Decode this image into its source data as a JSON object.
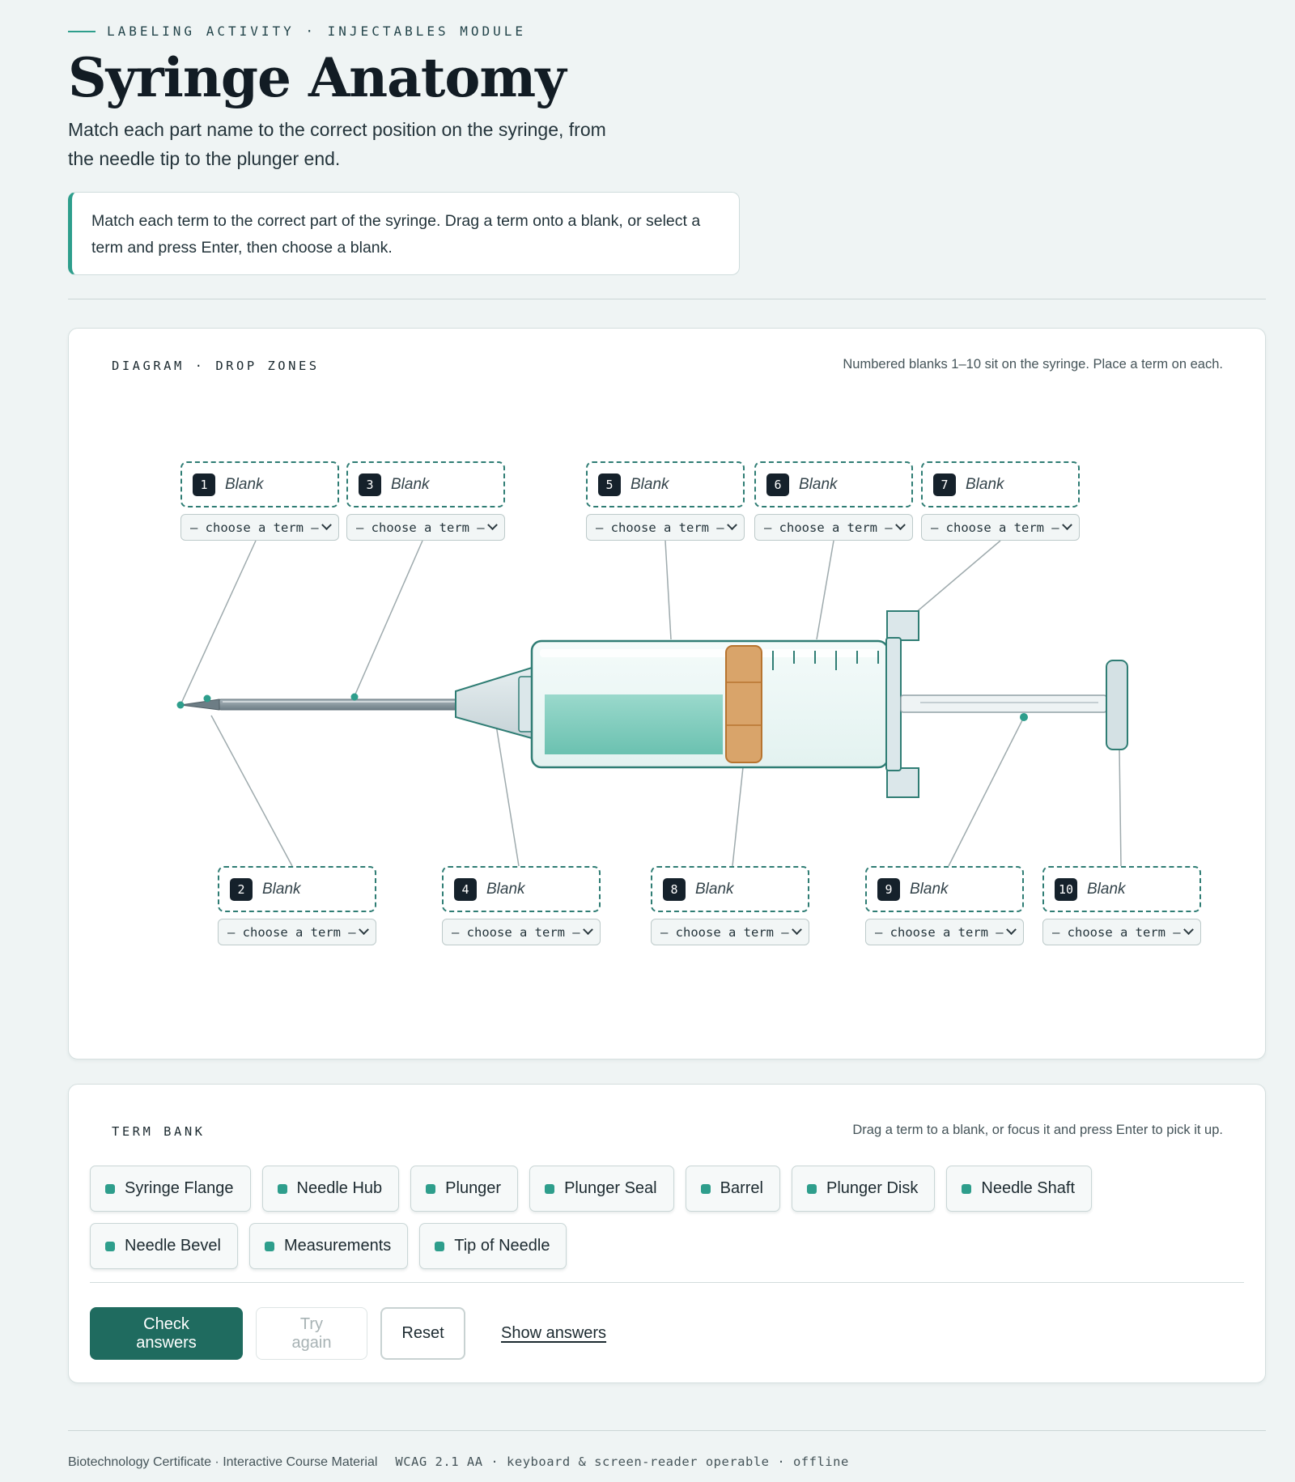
{
  "header": {
    "eyebrow": "LABELING ACTIVITY · INJECTABLES MODULE",
    "title": "Syringe Anatomy",
    "subtitle": "Match each part name to the correct position on the syringe, from the needle tip to the plunger end.",
    "instructions": "Match each term to the correct part of the syringe. Drag a term onto a blank, or select a term and press Enter, then choose a blank."
  },
  "diagram": {
    "heading": "DIAGRAM · DROP ZONES",
    "note": "Numbered blanks 1–10 sit on the syringe. Place a term on each.",
    "blanks": [
      {
        "num": "1",
        "label": "Blank",
        "select": "— choose a term —"
      },
      {
        "num": "2",
        "label": "Blank",
        "select": "— choose a term —"
      },
      {
        "num": "3",
        "label": "Blank",
        "select": "— choose a term —"
      },
      {
        "num": "4",
        "label": "Blank",
        "select": "— choose a term —"
      },
      {
        "num": "5",
        "label": "Blank",
        "select": "— choose a term —"
      },
      {
        "num": "6",
        "label": "Blank",
        "select": "— choose a term —"
      },
      {
        "num": "7",
        "label": "Blank",
        "select": "— choose a term —"
      },
      {
        "num": "8",
        "label": "Blank",
        "select": "— choose a term —"
      },
      {
        "num": "9",
        "label": "Blank",
        "select": "— choose a term —"
      },
      {
        "num": "10",
        "label": "Blank",
        "select": "— choose a term —"
      }
    ]
  },
  "bank": {
    "heading": "TERM BANK",
    "note": "Drag a term to a blank, or focus it and press Enter to pick it up.",
    "terms": [
      "Syringe Flange",
      "Needle Hub",
      "Plunger",
      "Plunger Seal",
      "Barrel",
      "Plunger Disk",
      "Needle Shaft",
      "Needle Bevel",
      "Measurements",
      "Tip of Needle"
    ]
  },
  "actions": {
    "check": "Check answers",
    "try_again": "Try again",
    "reset": "Reset",
    "show": "Show answers"
  },
  "footer": {
    "course": "Biotechnology Certificate · Interactive Course Material",
    "a11y": "WCAG 2.1 AA · keyboard & screen-reader operable · offline"
  },
  "colors": {
    "accent": "#2e9e8c",
    "primary_button": "#1f6b5f",
    "plunger_seal": "#d9a46a",
    "fluid": "#7fcfbf"
  }
}
